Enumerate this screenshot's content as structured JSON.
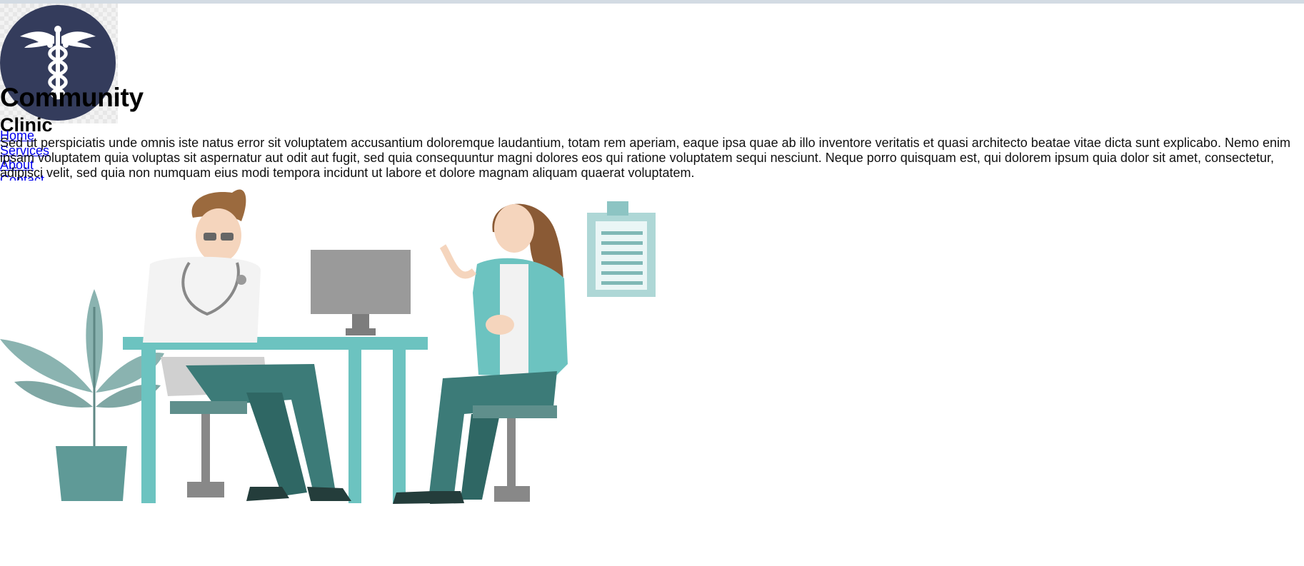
{
  "site": {
    "title": "Community",
    "subtitle": "Clinic"
  },
  "nav": {
    "items": [
      {
        "label": "Home"
      },
      {
        "label": "Services"
      },
      {
        "label": "About"
      },
      {
        "label": "Contact"
      }
    ]
  },
  "intro": {
    "text": "Sed ut perspiciatis unde omnis iste natus error sit voluptatem accusantium doloremque laudantium, totam rem aperiam, eaque ipsa quae ab illo inventore veritatis et quasi architecto beatae vitae dicta sunt explicabo. Nemo enim ipsam voluptatem quia voluptas sit aspernatur aut odit aut fugit, sed quia consequuntur magni dolores eos qui ratione voluptatem sequi nesciunt. Neque porro quisquam est, qui dolorem ipsum quia dolor sit amet, consectetur, adipisci velit, sed quia non numquam eius modi tempora incidunt ut labore et dolore magnam aliquam quaerat voluptatem."
  },
  "logo": {
    "icon": "caduceus-icon"
  },
  "hero": {
    "icon": "doctor-consultation-illustration"
  },
  "colors": {
    "logo_circle": "#343c5c",
    "teal": "#6cc3c0",
    "dark_teal": "#3c7b78",
    "gray_teal": "#7fa7a4",
    "link": "#0000ee"
  }
}
